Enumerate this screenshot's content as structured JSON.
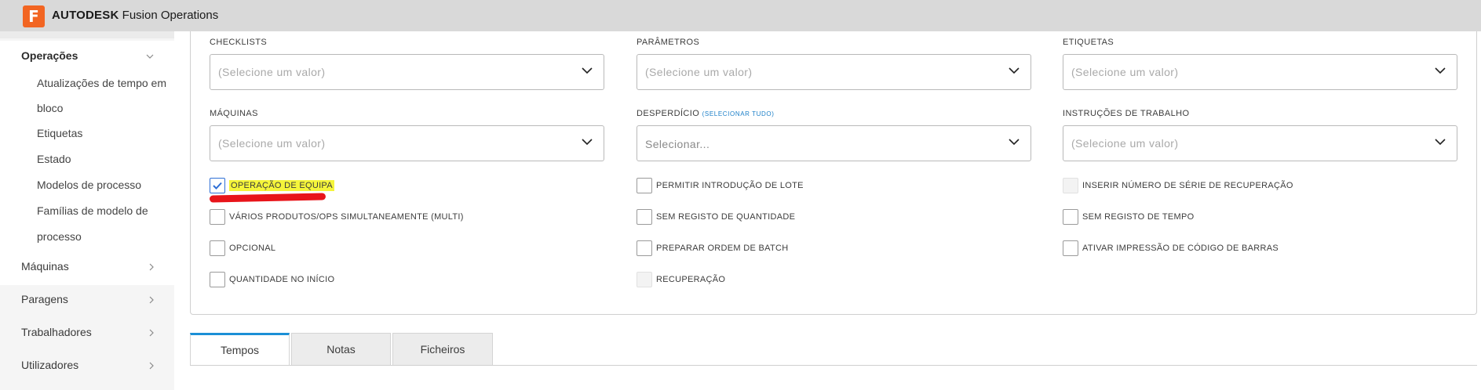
{
  "app": {
    "logo_letter": "F",
    "brand_bold": "AUTODESK",
    "brand_rest": " Fusion Operations",
    "brand_color": "#f26522"
  },
  "sidebar": {
    "operacoes": {
      "label": "Operações",
      "icon": "chevron-down-icon",
      "items": [
        "Atualizações de tempo em",
        "bloco",
        "Etiquetas",
        "Estado",
        "Modelos de processo",
        "Famílias de modelo de",
        "processo"
      ]
    },
    "sections": [
      {
        "label": "Máquinas",
        "icon": "chevron-right-icon"
      },
      {
        "label": "Paragens",
        "icon": "chevron-right-icon"
      },
      {
        "label": "Trabalhadores",
        "icon": "chevron-right-icon"
      },
      {
        "label": "Utilizadores",
        "icon": "chevron-right-icon"
      }
    ]
  },
  "form": {
    "fields": [
      {
        "label": "CHECKLISTS",
        "placeholder": "(Selecione um valor)"
      },
      {
        "label": "PARÂMETROS",
        "placeholder": "(Selecione um valor)"
      },
      {
        "label": "ETIQUETAS",
        "placeholder": "(Selecione um valor)"
      },
      {
        "label": "MÁQUINAS",
        "placeholder": "(Selecione um valor)"
      },
      {
        "label": "DESPERDÍCIO",
        "extra": "(SELECIONAR TUDO)",
        "placeholder": "Selecionar..."
      },
      {
        "label": "INSTRUÇÕES DE TRABALHO",
        "placeholder": "(Selecione um valor)"
      }
    ],
    "checkboxes": {
      "col1": [
        {
          "label": "OPERAÇÃO DE EQUIPA",
          "checked": true,
          "highlight": "#f5f53a"
        },
        {
          "label": "VÁRIOS PRODUTOS/OPS SIMULTANEAMENTE (MULTI)",
          "checked": false
        },
        {
          "label": "OPCIONAL",
          "checked": false
        },
        {
          "label": "QUANTIDADE NO INÍCIO",
          "checked": false
        }
      ],
      "col2": [
        {
          "label": "PERMITIR INTRODUÇÃO DE LOTE",
          "checked": false
        },
        {
          "label": "SEM REGISTO DE QUANTIDADE",
          "checked": false
        },
        {
          "label": "PREPARAR ORDEM DE BATCH",
          "checked": false
        },
        {
          "label": "RECUPERAÇÃO",
          "checked": false,
          "disabled": true
        }
      ],
      "col3": [
        {
          "label": "INSERIR NÚMERO DE SÉRIE DE RECUPERAÇÃO",
          "checked": false,
          "disabled": true
        },
        {
          "label": "SEM REGISTO DE TEMPO",
          "checked": false
        },
        {
          "label": "ATIVAR IMPRESSÃO DE CÓDIGO DE BARRAS",
          "checked": false
        }
      ]
    },
    "annotation_color": "#e8141a"
  },
  "tabs": [
    {
      "label": "Tempos",
      "active": true
    },
    {
      "label": "Notas",
      "active": false
    },
    {
      "label": "Ficheiros",
      "active": false
    }
  ],
  "accent": "#1b8fd6"
}
